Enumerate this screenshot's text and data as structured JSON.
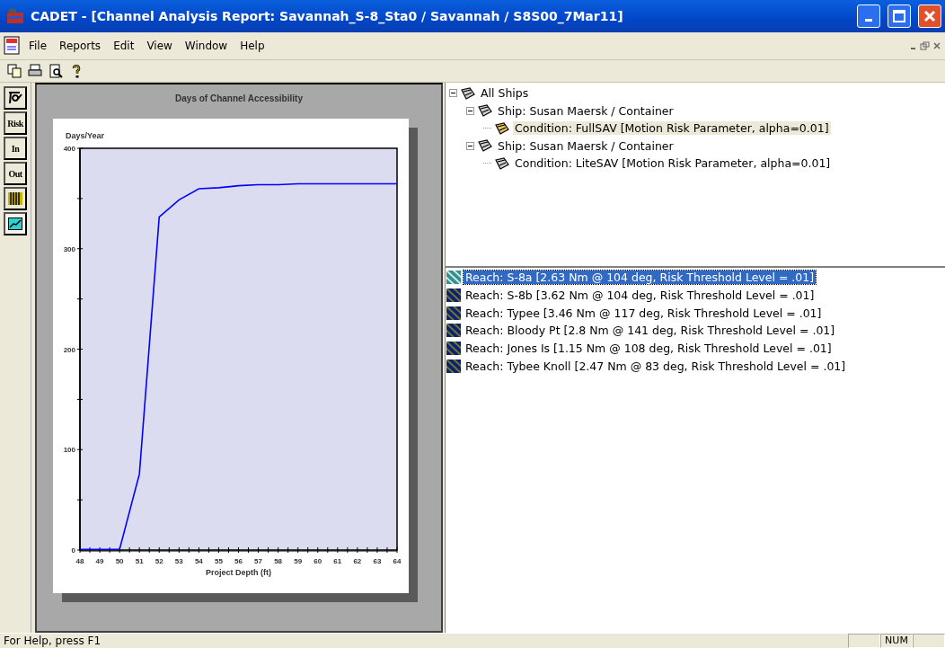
{
  "window": {
    "title": "CADET - [Channel Analysis Report: Savannah_S-8_Sta0 / Savannah / S8S00_7Mar11]"
  },
  "menu": [
    "File",
    "Reports",
    "Edit",
    "View",
    "Window",
    "Help"
  ],
  "toolbar": [
    {
      "kind": "copy"
    },
    {
      "kind": "print"
    },
    {
      "kind": "preview"
    },
    {
      "kind": "help"
    }
  ],
  "side_toolbar": [
    {
      "kind": "glyph",
      "selected": false
    },
    {
      "kind": "text",
      "label": "Risk",
      "selected": false
    },
    {
      "kind": "text",
      "label": "In",
      "selected": false
    },
    {
      "kind": "text",
      "label": "Out",
      "selected": false
    },
    {
      "kind": "bars",
      "selected": false
    },
    {
      "kind": "chart",
      "selected": true
    }
  ],
  "chart": {
    "chart_data": {
      "type": "line",
      "title": "Days of Channel Accessibility",
      "xlabel": "Project Depth (ft)",
      "ylabel": "Days/Year",
      "x": [
        48,
        49,
        50,
        51,
        52,
        53,
        54,
        55,
        56,
        57,
        58,
        59,
        60,
        61,
        62,
        63,
        64
      ],
      "series": [
        {
          "color": "#0000ff",
          "values": [
            0,
            0,
            0,
            75,
            331,
            348,
            359,
            360,
            362,
            363,
            363,
            364,
            364,
            364,
            364,
            364,
            364
          ]
        }
      ],
      "xlim": [
        48,
        64
      ],
      "ylim": [
        0,
        400
      ],
      "xticks": [
        48,
        49,
        50,
        51,
        52,
        53,
        54,
        55,
        56,
        57,
        58,
        59,
        60,
        61,
        62,
        63,
        64
      ],
      "yticks": [
        0,
        100,
        200,
        300,
        400
      ]
    }
  },
  "tree": [
    {
      "label": "All Ships",
      "selected": false,
      "expanded": true,
      "children": [
        {
          "label": "Ship: Susan Maersk / Container",
          "selected": false,
          "expanded": true,
          "children": [
            {
              "label": "Condition: FullSAV [Motion Risk Parameter, alpha=0.01]",
              "selected": true
            }
          ]
        },
        {
          "label": "Ship: Susan Maersk / Container",
          "selected": false,
          "expanded": true,
          "children": [
            {
              "label": "Condition: LiteSAV [Motion Risk Parameter, alpha=0.01]",
              "selected": false
            }
          ]
        }
      ]
    }
  ],
  "reaches": [
    {
      "label": "Reach: S-8a [2.63 Nm @ 104 deg, Risk Threshold Level = .01]",
      "selected": true
    },
    {
      "label": "Reach: S-8b [3.62 Nm @ 104 deg, Risk Threshold Level = .01]",
      "selected": false
    },
    {
      "label": "Reach: Typee [3.46 Nm @ 117 deg, Risk Threshold Level = .01]",
      "selected": false
    },
    {
      "label": "Reach: Bloody Pt [2.8 Nm @ 141 deg, Risk Threshold Level = .01]",
      "selected": false
    },
    {
      "label": "Reach: Jones Is [1.15 Nm @ 108 deg, Risk Threshold Level = .01]",
      "selected": false
    },
    {
      "label": "Reach: Tybee Knoll [2.47 Nm @ 83 deg, Risk Threshold Level = .01]",
      "selected": false
    }
  ],
  "status_bar": {
    "message": "For Help, press F1",
    "num_indicator": "NUM"
  }
}
